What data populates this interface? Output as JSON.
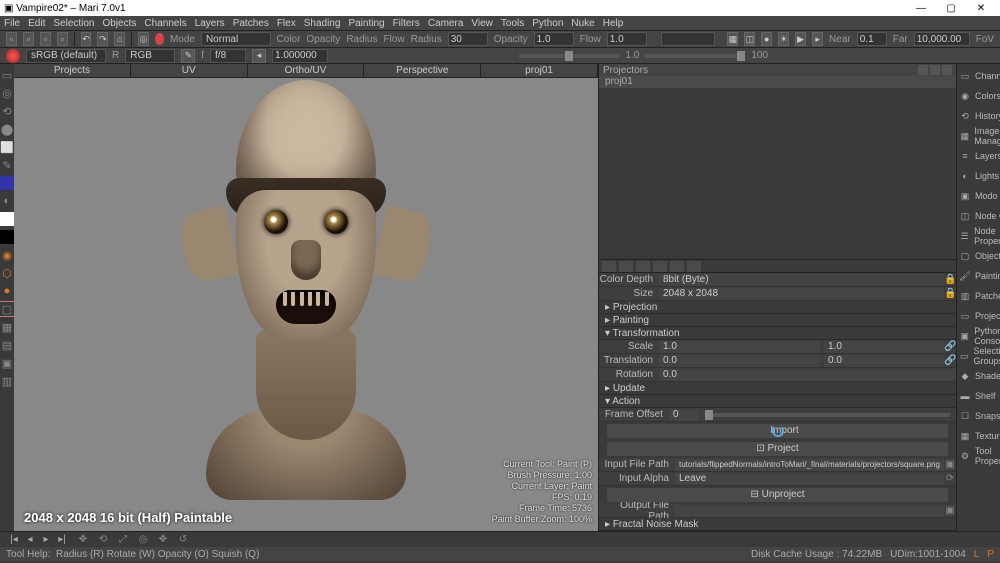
{
  "title": "Vampire02* – Mari 7.0v1",
  "window_buttons": {
    "min": "—",
    "max": "▢",
    "close": "✕"
  },
  "menu": [
    "File",
    "Edit",
    "Selection",
    "Objects",
    "Channels",
    "Layers",
    "Patches",
    "Flex",
    "Shading",
    "Painting",
    "Filters",
    "Camera",
    "View",
    "Tools",
    "Python",
    "Nuke",
    "Help"
  ],
  "toolbar1": {
    "mode_label": "Mode",
    "mode_value": "Normal",
    "color": "Color",
    "opacity": "Opacity",
    "radius": "Radius",
    "flow": "Flow",
    "radius_label": "Radius",
    "radius_value": "30",
    "opacity_label": "Opacity",
    "opacity_value": "1.0",
    "flow_label": "Flow",
    "flow_value": "1.0",
    "near_label": "Near",
    "near_value": "0.1",
    "far_label": "Far",
    "far_value": "10,000.00",
    "fov": "FoV"
  },
  "toolbar2": {
    "colorspace": "sRGB (default)",
    "r": "R",
    "channel": "RGB",
    "f_label": "f",
    "f_value": "f/8",
    "exposure": "1.000000",
    "slider_value": "1.0",
    "res": "100"
  },
  "viewport": {
    "tabs": [
      "Projects",
      "UV",
      "Ortho/UV",
      "Perspective",
      "proj01"
    ],
    "overlay_bl": "2048 x 2048 16 bit (Half) Paintable",
    "overlay_br": [
      "Current Tool: Paint (P)",
      "Brush Pressure: 1.00",
      "Current Layer: Paint",
      "FPS: 0.19",
      "Frame Time: 5736",
      "Paint Buffer Zoom: 100%"
    ]
  },
  "projectors": {
    "title": "Projectors",
    "item": "proj01",
    "color_depth_label": "Color Depth",
    "color_depth_value": "8bit (Byte)",
    "size_label": "Size",
    "size_value": "2048 x 2048",
    "sections": {
      "projection": "Projection",
      "painting": "Painting",
      "transformation": "Transformation",
      "update": "Update",
      "action": "Action"
    },
    "scale_label": "Scale",
    "scale_v1": "1.0",
    "scale_v2": "1.0",
    "translation_label": "Translation",
    "translation_v1": "0.0",
    "translation_v2": "0.0",
    "rotation_label": "Rotation",
    "rotation_v": "0.0",
    "frame_offset_label": "Frame Offset",
    "frame_offset_v": "0",
    "import_btn": "Import",
    "project_btn": "⊡ Project",
    "input_file_label": "Input File Path",
    "input_file_value": "tutorials/flippedNormals/introToMari/_final/materials/projectors/square.png",
    "input_alpha_label": "Input Alpha",
    "input_alpha_value": "Leave",
    "unproject_btn": "⊟ Unproject",
    "output_file_label": "Output File Path",
    "output_file_value": "",
    "fractal": "Fractal Noise Mask"
  },
  "right_rail": [
    "Channels",
    "Colors",
    "History View",
    "Image Manager",
    "Layers",
    "Lights",
    "Modo Render",
    "Node Graph",
    "Node Properties",
    "Objects",
    "Painting",
    "Patches",
    "Projectors",
    "Python Console",
    "Selection Groups",
    "Shaders",
    "Shelf",
    "Snapshots",
    "Texture Sets",
    "Tool Properties"
  ],
  "right_rail_icons": [
    "▭",
    "◉",
    "⟲",
    "▦",
    "≡",
    "◐",
    "▣",
    "◫",
    "☰",
    "▢",
    "🖌",
    "▥",
    "▭",
    "▣",
    "▭",
    "◆",
    "▬",
    "☐",
    "▦",
    "⚙"
  ],
  "status": {
    "tool_help": "Tool Help:",
    "hints": "Radius (R)    Rotate (W)    Opacity (O)    Squish (Q)",
    "disk": "Disk Cache Usage : 74.22MB",
    "udim": "UDim:1001-1004",
    "l": "L",
    "p": "P"
  }
}
